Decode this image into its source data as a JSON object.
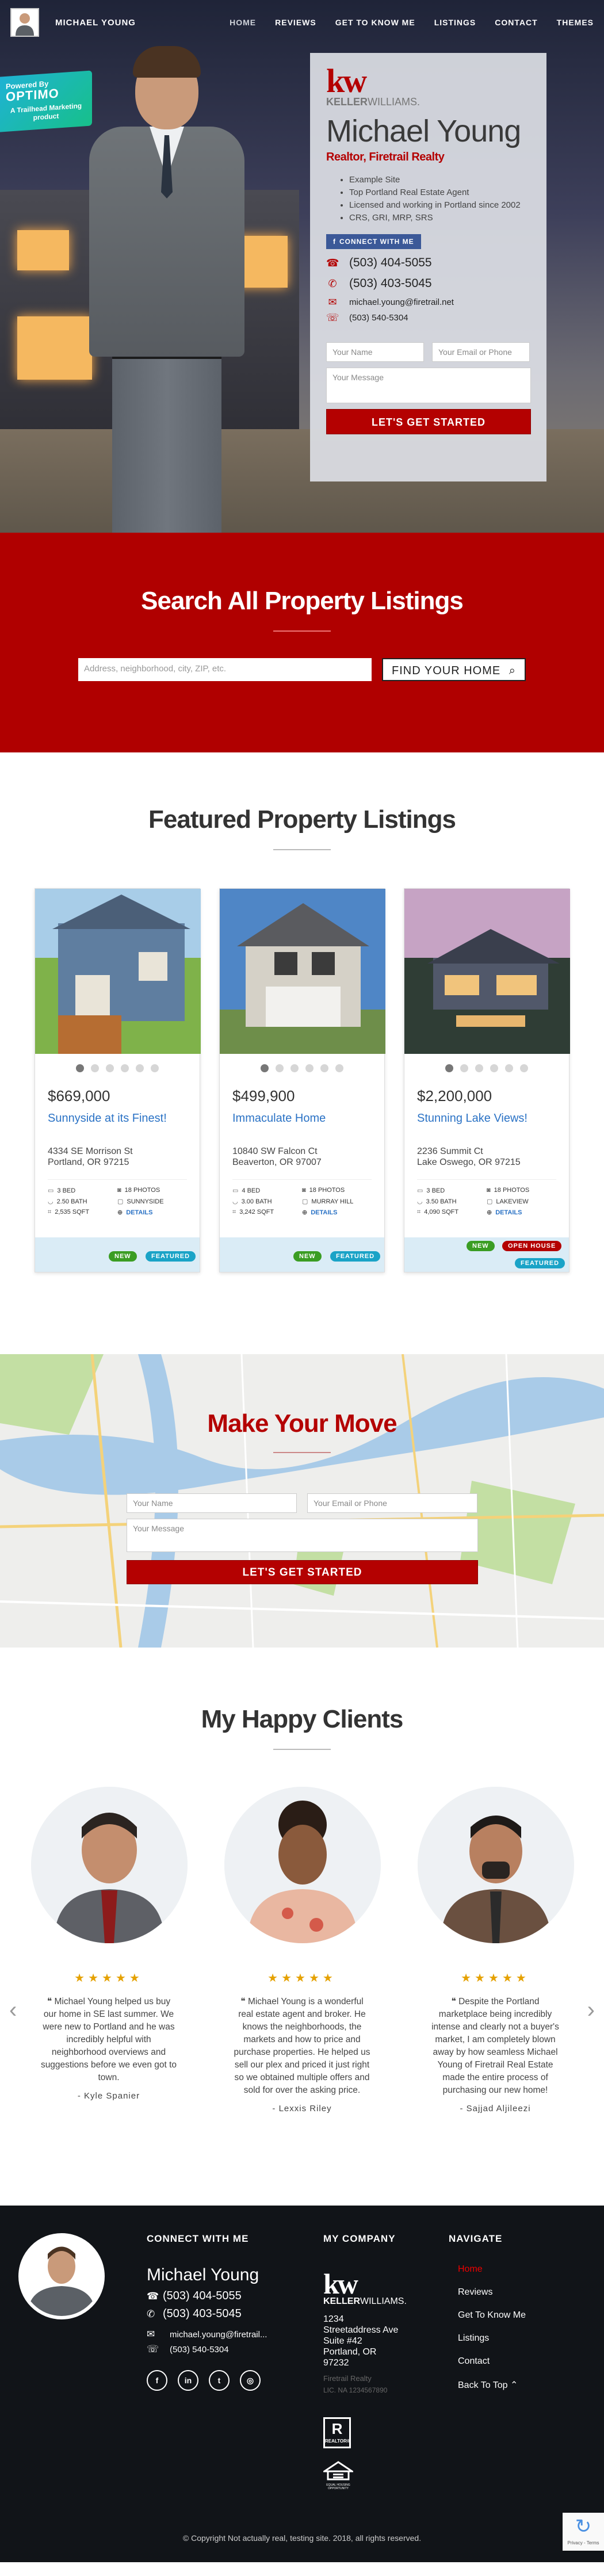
{
  "nav": {
    "name": "MICHAEL YOUNG",
    "links": [
      "HOME",
      "REVIEWS",
      "GET TO KNOW ME",
      "LISTINGS",
      "CONTACT",
      "THEMES"
    ]
  },
  "badge": {
    "line1": "Powered By",
    "line2": "OPTIMO",
    "line3": "A Trailhead Marketing product"
  },
  "hero": {
    "kw_mark": "kw",
    "kw_word_bold": "KELLER",
    "kw_word_rest": "WILLIAMS.",
    "name": "Michael Young",
    "title": "Realtor, Firetrail Realty",
    "bullets": [
      "Example Site",
      "Top Portland Real Estate Agent",
      "Licensed and working in Portland since 2002",
      "CRS, GRI, MRP, SRS"
    ],
    "connect_label": "CONNECT WITH ME",
    "phone1": "(503) 404-5055",
    "phone2": "(503) 403-5045",
    "email": "michael.young@firetrail.net",
    "fax": "(503) 540-5304",
    "form_name_placeholder": "Your Name",
    "form_email_placeholder": "Your Email or Phone",
    "form_msg_placeholder": "Your Message",
    "cta_label": "LET'S GET STARTED"
  },
  "search": {
    "title": "Search All Property Listings",
    "placeholder": "Address, neighborhood, city, ZIP, etc.",
    "button_label": "FIND YOUR HOME"
  },
  "listings": {
    "title": "Featured Property Listings",
    "cards": [
      {
        "price": "$669,000",
        "title": "Sunnyside at its Finest!",
        "addr1": "4334 SE Morrison St",
        "addr2": "Portland, OR 97215",
        "bed": "3 BED",
        "bath": "2.50 BATH",
        "sqft": "2,535 SQFT",
        "photos": "18 PHOTOS",
        "area": "SUNNYSIDE",
        "details": "DETAILS",
        "tags": [
          "NEW",
          "FEATURED"
        ]
      },
      {
        "price": "$499,900",
        "title": "Immaculate Home",
        "addr1": "10840 SW Falcon Ct",
        "addr2": "Beaverton, OR 97007",
        "bed": "4 BED",
        "bath": "3.00 BATH",
        "sqft": "3,242 SQFT",
        "photos": "18 PHOTOS",
        "area": "MURRAY HILL",
        "details": "DETAILS",
        "tags": [
          "NEW",
          "FEATURED"
        ]
      },
      {
        "price": "$2,200,000",
        "title": "Stunning Lake Views!",
        "addr1": "2236 Summit Ct",
        "addr2": "Lake Oswego, OR 97215",
        "bed": "3 BED",
        "bath": "3.50 BATH",
        "sqft": "4,090 SQFT",
        "photos": "18 PHOTOS",
        "area": "LAKEVIEW",
        "details": "DETAILS",
        "tags": [
          "NEW",
          "OPEN HOUSE",
          "FEATURED"
        ]
      }
    ]
  },
  "move": {
    "title": "Make Your Move",
    "name_placeholder": "Your Name",
    "email_placeholder": "Your Email or Phone",
    "msg_placeholder": "Your Message",
    "cta_label": "LET'S GET STARTED"
  },
  "clients": {
    "title": "My Happy Clients",
    "stars": "★★★★★",
    "items": [
      {
        "text": "Michael Young helped us buy our home in SE last summer. We were new to Portland and he was incredibly helpful with neighborhood overviews and suggestions before we even got to town.",
        "name": "- Kyle Spanier"
      },
      {
        "text": "Michael Young is a wonderful real estate agent and broker. He knows the neighborhoods, the markets and how to price and purchase properties. He helped us sell our plex and priced it just right so we obtained multiple offers and sold for over the asking price.",
        "name": "- Lexxis Riley"
      },
      {
        "text": "Despite the Portland marketplace being incredibly intense and clearly not a buyer's market, I am completely blown away by how seamless Michael Young of Firetrail Real Estate made the entire process of purchasing our new home!",
        "name": "- Sajjad Aljileezi"
      }
    ]
  },
  "footer": {
    "connect_heading": "CONNECT WITH ME",
    "name": "Michael Young",
    "phone1": "(503) 404-5055",
    "phone2": "(503) 403-5045",
    "email": "michael.young@firetrail...",
    "fax": "(503) 540-5304",
    "company_heading": "MY COMPANY",
    "kw_mark": "kw",
    "kw_word_bold": "KELLER",
    "kw_word_rest": "WILLIAMS.",
    "addr1": "1234",
    "addr2": "Streetaddress Ave",
    "addr3": "Suite #42",
    "addr4": "Portland, OR",
    "addr5": "97232",
    "company_name": "Firetrail Realty",
    "license": "LIC. NA 1234567890",
    "realtor_mark": "R",
    "realtor_label": "REALTOR®",
    "eho_label": "EQUAL HOUSING OPPORTUNITY",
    "nav_heading": "NAVIGATE",
    "nav_links": [
      "Home",
      "Reviews",
      "Get To Know Me",
      "Listings",
      "Contact",
      "Back To Top ⌃"
    ],
    "copyright": "© Copyright Not actually real, testing site. 2018, all rights reserved.",
    "recaptcha_label": "Privacy - Terms"
  },
  "colors": {
    "brand_red": "#b40101",
    "link_blue": "#2a72c5",
    "tag_green": "#3a9d23",
    "tag_teal": "#1aa3c7"
  },
  "icons": {
    "phone": "☎",
    "mobile": "✆",
    "email": "✉",
    "fax": "☏",
    "search": "⌕",
    "chevron_left": "‹",
    "chevron_right": "›",
    "facebook": "f",
    "linkedin": "in",
    "twitter": "t",
    "instagram": "◎"
  }
}
